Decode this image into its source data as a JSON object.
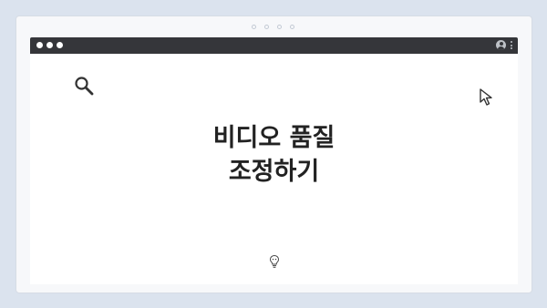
{
  "window": {
    "traffic_lights": [
      "close",
      "minimize",
      "maximize"
    ],
    "icons": {
      "profile": "profile-icon",
      "menu": "kebab-menu-icon",
      "search": "search-icon",
      "cursor": "cursor-icon",
      "bulb": "lightbulb-icon"
    },
    "colors": {
      "background": "#dbe3ee",
      "titlebar": "#35363a",
      "text": "#222222"
    }
  },
  "content": {
    "title_line1": "비디오 품질",
    "title_line2": "조정하기"
  }
}
